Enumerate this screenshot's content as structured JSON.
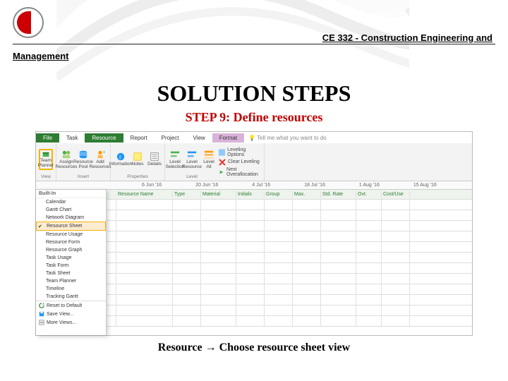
{
  "course": {
    "right": "CE 332 - Construction Engineering and",
    "left": "Management"
  },
  "title": "SOLUTION STEPS",
  "step": "STEP 9: Define resources",
  "caption": "Resource → Choose resource sheet view",
  "ribbon": {
    "tabs": [
      "File",
      "Task",
      "Resource",
      "Report",
      "Project",
      "View",
      "Format"
    ],
    "tellme": "Tell me what you want to do",
    "groups": {
      "view": {
        "teamPlanner": "Team Planner",
        "label": "View"
      },
      "assign": {
        "assign": "Assign Resources",
        "pool": "Resource Pool",
        "add": "Add Resources",
        "label": "Insert"
      },
      "properties": {
        "info": "Information",
        "notes": "Notes",
        "details": "Details",
        "label": "Properties"
      },
      "level": {
        "sel": "Level Selection",
        "res": "Level Resource",
        "all": "Level All",
        "clear": "Clear Leveling",
        "opts": "Leveling Options",
        "next": "Next Overallocation",
        "label": "Level"
      }
    }
  },
  "timeline": [
    "6 Jun '16",
    "20 Jun '16",
    "4 Jul '16",
    "18 Jul '16",
    "1 Aug '16",
    "15 Aug '16"
  ],
  "dropdown": {
    "builtIn": "Built-In",
    "items": [
      "Calendar",
      "Gantt Chart",
      "Network Diagram",
      "Resource Sheet",
      "Resource Usage",
      "Resource Form",
      "Resource Graph",
      "Task Usage",
      "Task Form",
      "Task Sheet",
      "Team Planner",
      "Timeline",
      "Tracking Gantt"
    ],
    "footer": [
      "Reset to Default",
      "Save View...",
      "More Views..."
    ]
  },
  "sheet": {
    "cols": [
      "",
      "Resource Name",
      "Type",
      "Material",
      "Initials",
      "Group",
      "Max.",
      "Std. Rate",
      "Ovt.",
      "Cost/Use"
    ]
  }
}
